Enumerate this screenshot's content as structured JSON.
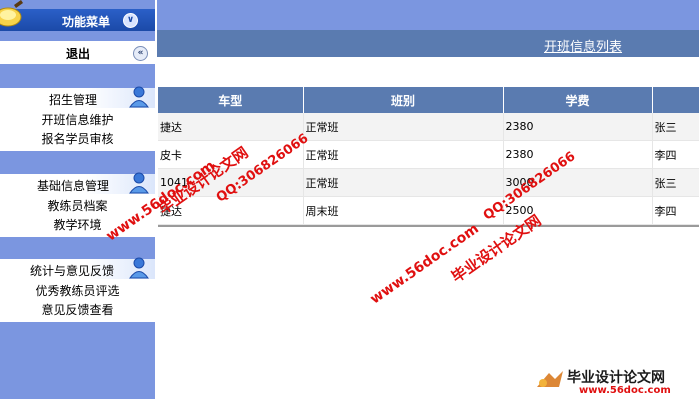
{
  "sidebar": {
    "menu_title": "功能菜单",
    "logout_label": "退出",
    "groups": [
      {
        "title": "招生管理",
        "items": [
          "开班信息维护",
          "报名学员审核"
        ]
      },
      {
        "title": "基础信息管理",
        "items": [
          "教练员档案",
          "教学环境"
        ]
      },
      {
        "title": "统计与意见反馈",
        "items": [
          "优秀教练员评选",
          "意见反馈查看"
        ]
      }
    ]
  },
  "main": {
    "title": "开班信息列表",
    "table": {
      "headers": [
        "车型",
        "班别",
        "学费",
        ""
      ],
      "rows": [
        [
          "捷达",
          "正常班",
          "2380",
          "张三"
        ],
        [
          "皮卡",
          "正常班",
          "2380",
          "李四"
        ],
        [
          "1041",
          "正常班",
          "3000",
          "张三"
        ],
        [
          "捷达",
          "周末班",
          "2500",
          "李四"
        ]
      ]
    }
  },
  "watermarks": {
    "site_url": "www.56doc.com",
    "qq": "QQ:306826066",
    "brand": "毕业设计论文网",
    "footer_brand": "毕业设计论文网",
    "footer_url": "www.56doc.com"
  },
  "colors": {
    "sidebar_bg": "#7b96e0",
    "header_bar": "#5a7bb0",
    "menu_header": "#1b4aa8",
    "watermark_red": "#e01010"
  }
}
